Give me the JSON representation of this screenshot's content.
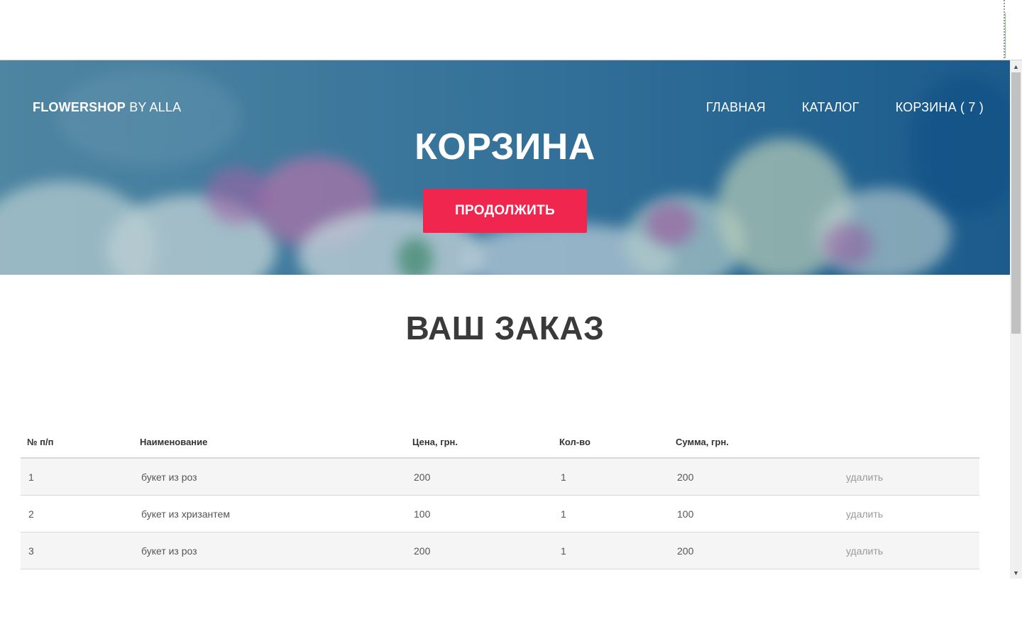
{
  "header": {
    "brand_bold": "FLOWERSHOP",
    "brand_rest": " BY ALLA",
    "nav": [
      {
        "label": "ГЛАВНАЯ"
      },
      {
        "label": "КАТАЛОГ"
      },
      {
        "label": "КОРЗИНА ( 7 )"
      }
    ]
  },
  "hero": {
    "title": "КОРЗИНА",
    "button_label": "ПРОДОЛЖИТЬ",
    "accent_color": "#f0264f"
  },
  "order": {
    "title": "ВАШ ЗАКАЗ",
    "columns": [
      "№ п/п",
      "Наименование",
      "Цена, грн.",
      "Кол-во",
      "Сумма, грн.",
      ""
    ],
    "rows": [
      {
        "num": "1",
        "name": "букет из роз",
        "price": "200",
        "qty": "1",
        "sum": "200",
        "action": "удалить"
      },
      {
        "num": "2",
        "name": "букет из хризантем",
        "price": "100",
        "qty": "1",
        "sum": "100",
        "action": "удалить"
      },
      {
        "num": "3",
        "name": "букет из роз",
        "price": "200",
        "qty": "1",
        "sum": "200",
        "action": "удалить"
      }
    ]
  },
  "icons": {
    "scroll_up": "▲",
    "scroll_down": "▼"
  }
}
